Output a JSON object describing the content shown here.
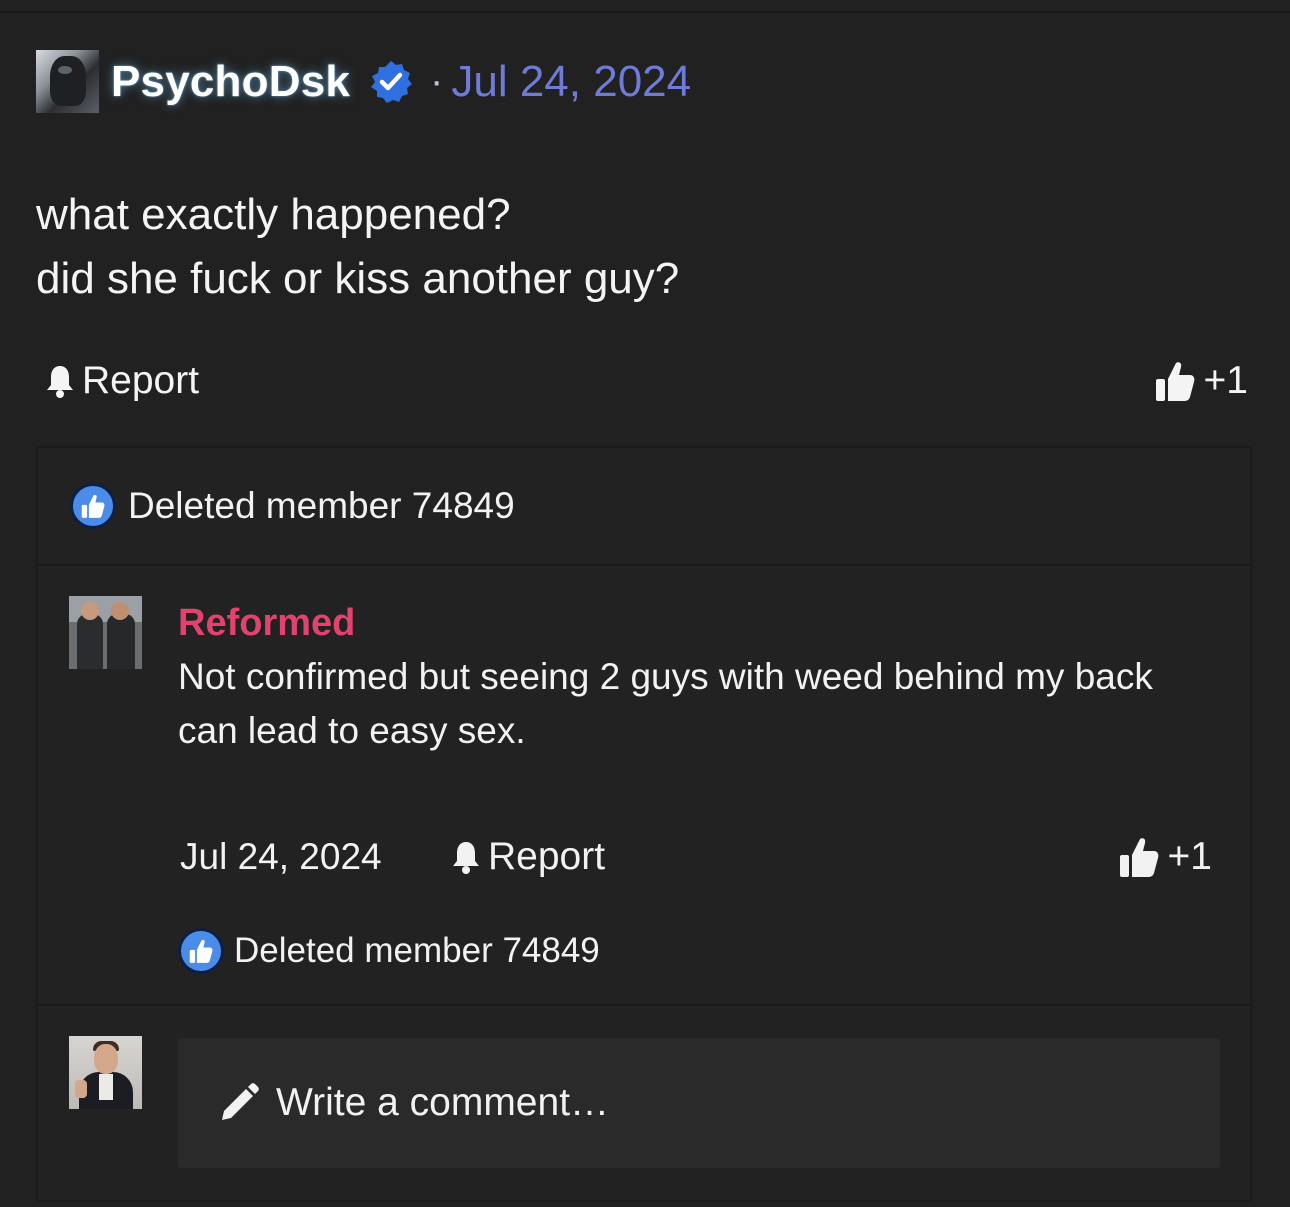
{
  "post": {
    "author": "PsychoDsk",
    "separator": "·",
    "date": "Jul 24, 2024",
    "body_lines": [
      "what exactly happened?",
      "did she fuck or kiss another guy?"
    ],
    "report_label": "Report",
    "like_count": "+1",
    "reacted_by": "Deleted member 74849"
  },
  "reply": {
    "author": "Reformed",
    "text": "Not confirmed but seeing 2 guys with weed behind my back can lead to easy sex.",
    "date": "Jul 24, 2024",
    "report_label": "Report",
    "like_count": "+1",
    "reacted_by": "Deleted member 74849"
  },
  "comment_box": {
    "placeholder": "Write a comment…"
  },
  "colors": {
    "background": "#212121",
    "date_accent": "#6f7bd8",
    "reply_author": "#e0436e",
    "verified_badge": "#2f6fe0",
    "like_badge": "#4a8ce8"
  },
  "icons": [
    "verified-badge-icon",
    "bell-icon",
    "thumbs-up-icon",
    "like-reaction-icon",
    "pencil-icon"
  ]
}
